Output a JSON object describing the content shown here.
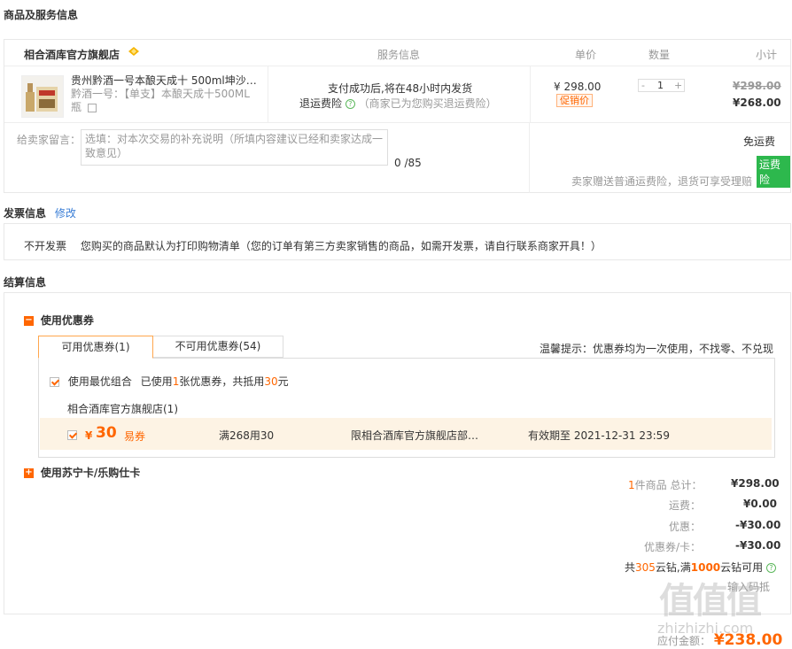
{
  "goods": {
    "section_title": "商品及服务信息",
    "store_name": "相合酒库官方旗舰店",
    "headers": {
      "service": "服务信息",
      "unit_price": "单价",
      "quantity": "数量",
      "subtotal": "小计"
    },
    "item": {
      "name_line1": "贵州黔酒一号本酿天成十 500ml坤沙…",
      "name_line2": "黔酒一号：【单支】本酿天成十500ML",
      "name_line3": "瓶",
      "service_line1": "支付成功后,将在48小时内发货",
      "service_line2_link": "退运费险",
      "service_line2_note": "（商家已为您购买退运费险）",
      "price": "¥ 298.00",
      "promo_tag": "促销价",
      "qty_minus": "-",
      "qty": "1",
      "qty_plus": "+",
      "subtotal_old": "¥298.00",
      "subtotal_new": "¥268.00"
    },
    "message_label": "给卖家留言：",
    "message_placeholder": "选填：对本次交易的补充说明（所填内容建议已经和卖家达成一致意见）",
    "message_count": "0 /85",
    "shipping": "免运费",
    "insurance_badge": "运费险",
    "insurance_note": "卖家赠送普通运费险，退货可享受理赔"
  },
  "invoice": {
    "section_title": "发票信息",
    "edit_link": "修改",
    "type": "不开发票",
    "note": "您购买的商品默认为打印购物清单（您的订单有第三方卖家销售的商品，如需开发票，请自行联系商家开具！）"
  },
  "settlement": {
    "section_title": "结算信息",
    "coupon_title": "使用优惠券",
    "tab_available": "可用优惠券(1)",
    "tab_unavailable": "不可用优惠券(54)",
    "tip": "温馨提示：优惠券均为一次使用，不找零、不兑现",
    "best_combo_label": "使用最优组合",
    "best_combo_prefix": "已使用",
    "best_combo_count": "1",
    "best_combo_mid": "张优惠券，共抵用",
    "best_combo_amount": "30",
    "best_combo_suffix": "元",
    "coupon_store": "相合酒库官方旗舰店(1)",
    "coupon": {
      "currency": "¥",
      "amount": "30",
      "type": "易券",
      "condition": "满268用30",
      "scope": "限相合酒库官方旗舰店部…",
      "validity": "有效期至 2021-12-31 23:59"
    },
    "card_title": "使用苏宁卡/乐购仕卡"
  },
  "summary": {
    "count": "1",
    "count_label": "件商品 总计：",
    "total": "¥298.00",
    "shipping_label": "运费：",
    "shipping": "¥0.00",
    "discount_label": "优惠：",
    "discount": "-¥30.00",
    "coupon_label": "优惠券/卡：",
    "coupon": "-¥30.00",
    "diamond_prefix": "共",
    "diamond_count": "305",
    "diamond_mid": "云钻,满",
    "diamond_threshold": "1000",
    "diamond_suffix": "云钻可用",
    "extra_text": "输入码抵",
    "pay_label": "应付金额：",
    "pay_amount": "¥238.00"
  },
  "watermark": {
    "text": "zhizhizhi.com",
    "logo": "值值值"
  }
}
